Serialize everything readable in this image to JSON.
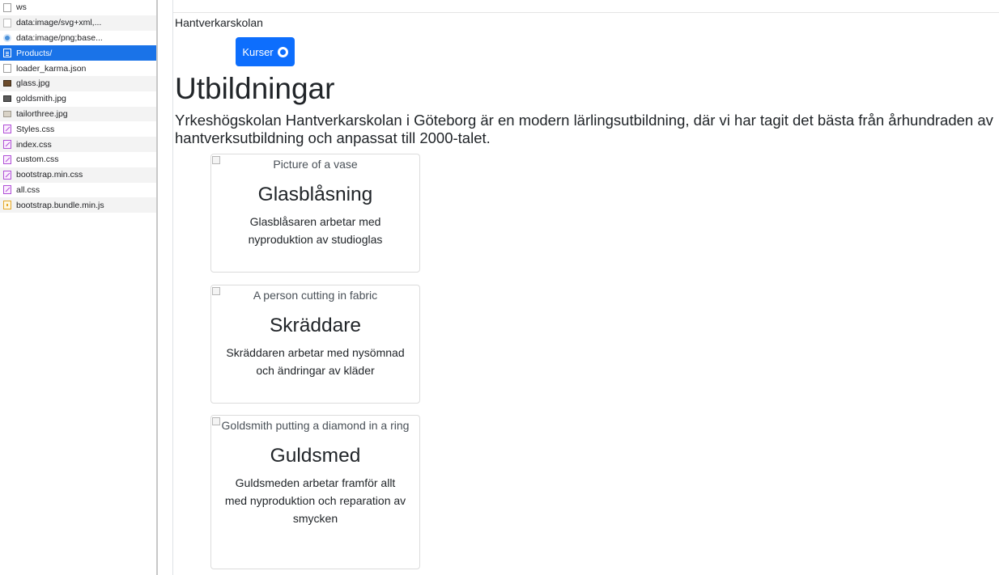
{
  "requests": [
    {
      "name": "ws",
      "icon": "doc-icon"
    },
    {
      "name": "data:image/svg+xml,...",
      "icon": "svg-icon"
    },
    {
      "name": "data:image/png;base...",
      "icon": "png-icon"
    },
    {
      "name": "Products/",
      "icon": "page-icon",
      "selected": true
    },
    {
      "name": "loader_karma.json",
      "icon": "json-icon"
    },
    {
      "name": "glass.jpg",
      "icon": "image-icon"
    },
    {
      "name": "goldsmith.jpg",
      "icon": "image-icon"
    },
    {
      "name": "tailorthree.jpg",
      "icon": "image-icon"
    },
    {
      "name": "Styles.css",
      "icon": "css-icon"
    },
    {
      "name": "index.css",
      "icon": "css-icon"
    },
    {
      "name": "custom.css",
      "icon": "css-icon"
    },
    {
      "name": "bootstrap.min.css",
      "icon": "css-icon"
    },
    {
      "name": "all.css",
      "icon": "css-icon"
    },
    {
      "name": "bootstrap.bundle.min.js",
      "icon": "js-icon"
    }
  ],
  "page": {
    "brand": "Hantverkarskolan",
    "button_label": "Kurser",
    "heading": "Utbildningar",
    "lead": "Yrkeshögskolan Hantverkarskolan i Göteborg är en modern lärlingsutbildning, där vi har tagit det bästa från århundraden av hantverksutbildning och anpassat till 2000-talet."
  },
  "cards": [
    {
      "alt": "Picture of a vase",
      "title": "Glasblåsning",
      "text": "Glasblåsaren arbetar med nyproduktion av studioglas"
    },
    {
      "alt": "A person cutting in fabric",
      "title": "Skräddare",
      "text": "Skräddaren arbetar med nysömnad och ändringar av kläder"
    },
    {
      "alt": "Goldsmith putting a diamond in a ring",
      "title": "Guldsmed",
      "text": "Guldsmeden arbetar framför allt med nyproduktion och reparation av smycken"
    }
  ],
  "colors": {
    "selected_row": "#1a73e8",
    "button": "#0d6efd"
  }
}
